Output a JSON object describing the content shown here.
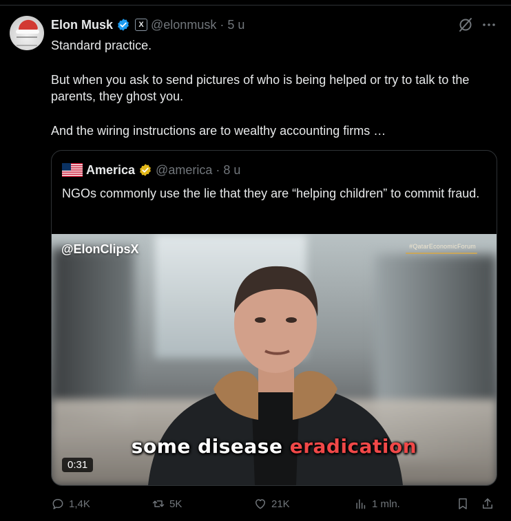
{
  "author": {
    "name": "Elon Musk",
    "handle": "@elonmusk",
    "separator": "·",
    "time": "5 u",
    "badge_text": "X",
    "verified_color": "#1d9bf0"
  },
  "tweet": {
    "paragraphs": [
      "Standard practice.",
      "But when you ask to send pictures of who is being helped or try to talk to the parents, they ghost you.",
      "And the wiring instructions are to wealthy accounting firms …"
    ]
  },
  "quoted": {
    "name": "America",
    "handle": "@america",
    "separator": "·",
    "time": "8 u",
    "verified_color": "#e2b719",
    "text": "NGOs commonly use the lie that they are “helping children” to commit fraud.",
    "video": {
      "watermark": "@ElonClipsX",
      "event_tag": "#QatarEconomicForum",
      "caption_white": "some disease",
      "caption_red": "eradication",
      "duration": "0:31"
    }
  },
  "actions": {
    "replies": "1,4K",
    "reposts": "5K",
    "likes": "21K",
    "views": "1 mln."
  },
  "colors": {
    "background": "#000000",
    "text": "#e7e9ea",
    "muted": "#71767b",
    "border": "#2f3336"
  }
}
